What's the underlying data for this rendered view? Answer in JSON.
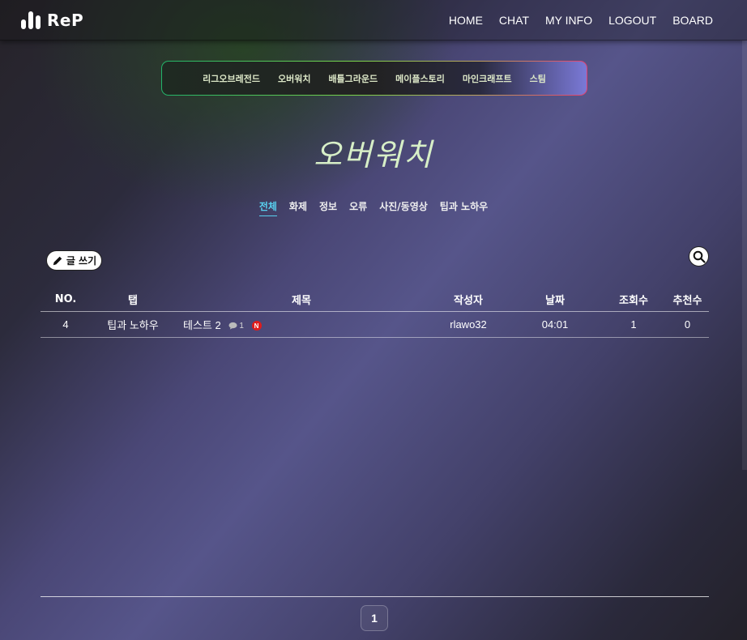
{
  "app": {
    "logo_text": "ReP"
  },
  "nav": {
    "items": [
      "HOME",
      "CHAT",
      "MY INFO",
      "LOGOUT",
      "BOARD"
    ]
  },
  "games": {
    "items": [
      "리그오브레전드",
      "오버워치",
      "배틀그라운드",
      "메이플스토리",
      "마인크래프트",
      "스팀"
    ]
  },
  "page": {
    "title": "오버워치"
  },
  "categories": {
    "items": [
      "전체",
      "화제",
      "정보",
      "오류",
      "사진/동영상",
      "팁과 노하우"
    ],
    "active": "전체"
  },
  "toolbar": {
    "write_label": "글 쓰기"
  },
  "table": {
    "headers": [
      "NO.",
      "탭",
      "제목",
      "작성자",
      "날짜",
      "조회수",
      "추천수"
    ],
    "rows": [
      {
        "no": "4",
        "tab": "팁과 노하우",
        "title": "테스트 2",
        "comments": "1",
        "badge": "N",
        "author": "rlawo32",
        "date": "04:01",
        "views": "1",
        "likes": "0"
      }
    ]
  },
  "pagination": {
    "current": "1"
  },
  "colors": {
    "active_category": "#58d0ef",
    "new_badge": "#e01c1c",
    "title": "#d7efc7"
  }
}
